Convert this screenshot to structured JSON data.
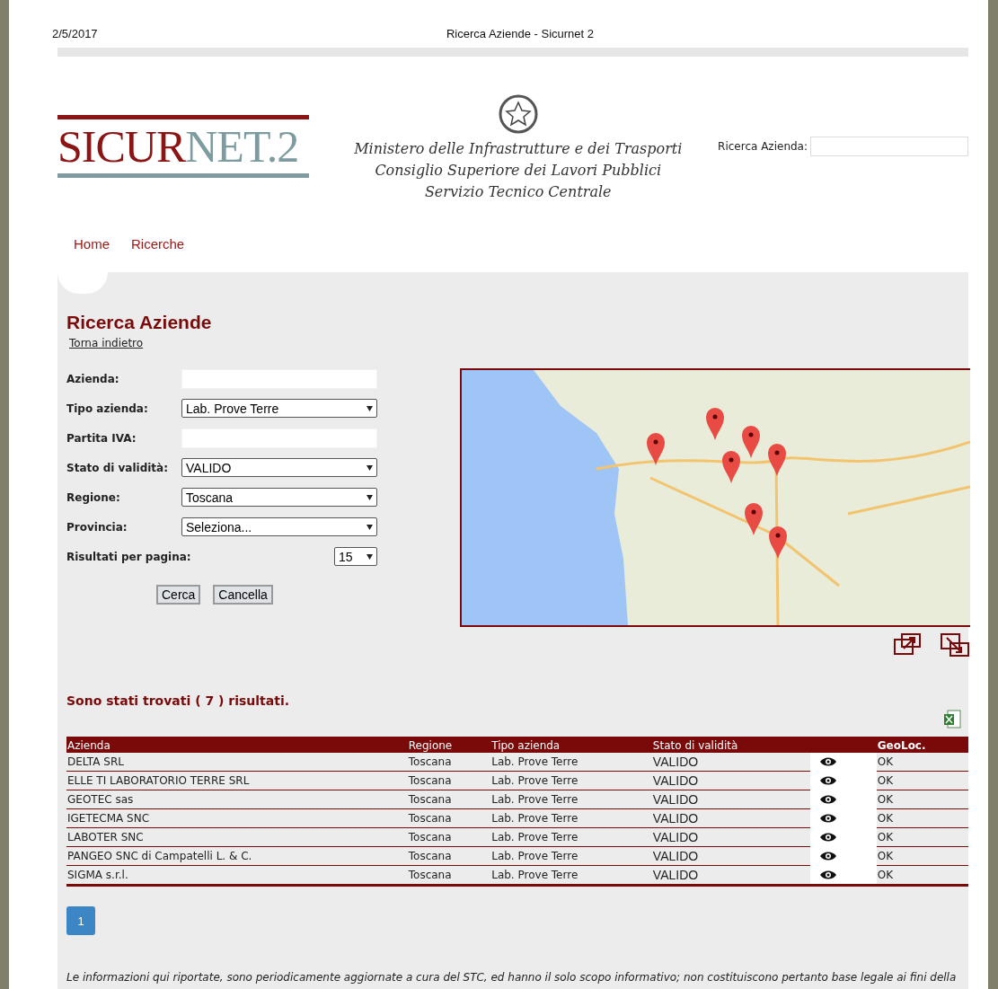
{
  "print_header": {
    "date": "2/5/2017",
    "title": "Ricerca Aziende - Sicurnet 2"
  },
  "header": {
    "logo_dark": "SICUR",
    "logo_light": "NET.2",
    "ministry_lines": [
      "Ministero delle Infrastrutture e dei Trasporti",
      "Consiglio Superiore dei Lavori Pubblici",
      "Servizio Tecnico Centrale"
    ],
    "search_label": "Ricerca Azienda:"
  },
  "nav": [
    "Home",
    "Ricerche"
  ],
  "page": {
    "title": "Ricerca Aziende",
    "back_link": "Torna indietro"
  },
  "form": {
    "fields": [
      {
        "kind": "text",
        "label": "Azienda:"
      },
      {
        "kind": "select",
        "label": "Tipo azienda:",
        "value": "Lab. Prove Terre"
      },
      {
        "kind": "text",
        "label": "Partita IVA:"
      },
      {
        "kind": "select",
        "label": "Stato di validità:",
        "value": "VALIDO"
      },
      {
        "kind": "select",
        "label": "Regione:",
        "value": "Toscana"
      },
      {
        "kind": "select",
        "label": "Provincia:",
        "value": "Seleziona..."
      },
      {
        "kind": "small_select",
        "label": "Risultati per pagina:",
        "value": "15"
      }
    ],
    "buttons": [
      "Cerca",
      "Cancella"
    ]
  },
  "results": {
    "summary": "Sono stati trovati ( 7 ) risultati.",
    "columns": [
      "Azienda",
      "Regione",
      "Tipo azienda",
      "Stato di validità",
      "GeoLoc."
    ],
    "rows": [
      [
        "DELTA SRL",
        "Toscana",
        "Lab. Prove Terre",
        "VALIDO",
        "OK"
      ],
      [
        "ELLE TI LABORATORIO TERRE SRL",
        "Toscana",
        "Lab. Prove Terre",
        "VALIDO",
        "OK"
      ],
      [
        "GEOTEC sas",
        "Toscana",
        "Lab. Prove Terre",
        "VALIDO",
        "OK"
      ],
      [
        "IGETECMA SNC",
        "Toscana",
        "Lab. Prove Terre",
        "VALIDO",
        "OK"
      ],
      [
        "LABOTER SNC",
        "Toscana",
        "Lab. Prove Terre",
        "VALIDO",
        "OK"
      ],
      [
        "PANGEO SNC di Campatelli L. & C.",
        "Toscana",
        "Lab. Prove Terre",
        "VALIDO",
        "OK"
      ],
      [
        "SIGMA s.r.l.",
        "Toscana",
        "Lab. Prove Terre",
        "VALIDO",
        "OK"
      ]
    ]
  },
  "pagination": [
    {
      "label": "1",
      "selected": true
    }
  ],
  "footer": {
    "note": "Le informazioni qui riportate, sono periodicamente aggiornate a cura del STC, ed hanno il solo scopo informativo; non costituiscono pertanto base legale ai fini della"
  }
}
